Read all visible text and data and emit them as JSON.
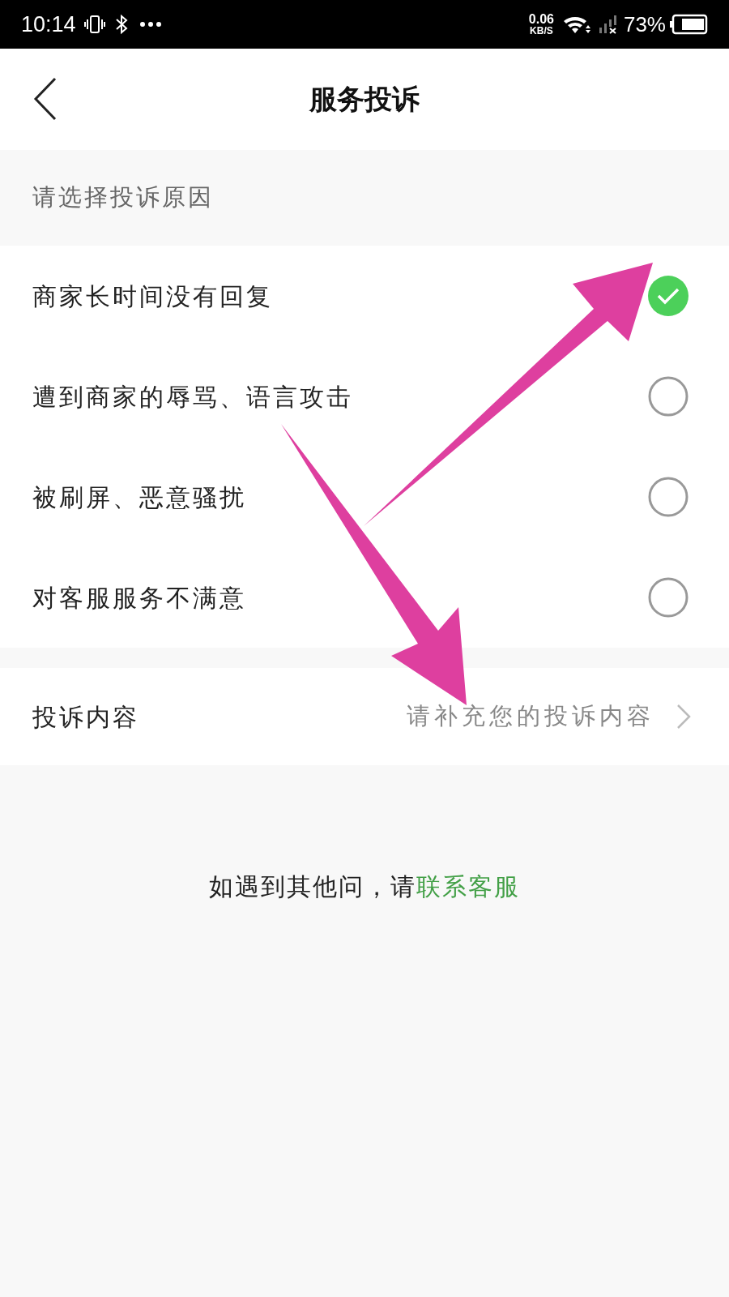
{
  "status_bar": {
    "time": "10:14",
    "speed_value": "0.06",
    "speed_unit": "KB/S",
    "battery": "73%"
  },
  "header": {
    "title": "服务投诉"
  },
  "section_title": "请选择投诉原因",
  "reasons": [
    {
      "label": "商家长时间没有回复",
      "selected": true
    },
    {
      "label": "遭到商家的辱骂、语言攻击",
      "selected": false
    },
    {
      "label": "被刷屏、恶意骚扰",
      "selected": false
    },
    {
      "label": "对客服服务不满意",
      "selected": false
    }
  ],
  "content_row": {
    "label": "投诉内容",
    "placeholder": "请补充您的投诉内容"
  },
  "footer": {
    "text": "如遇到其他问，请",
    "link": "联系客服"
  }
}
